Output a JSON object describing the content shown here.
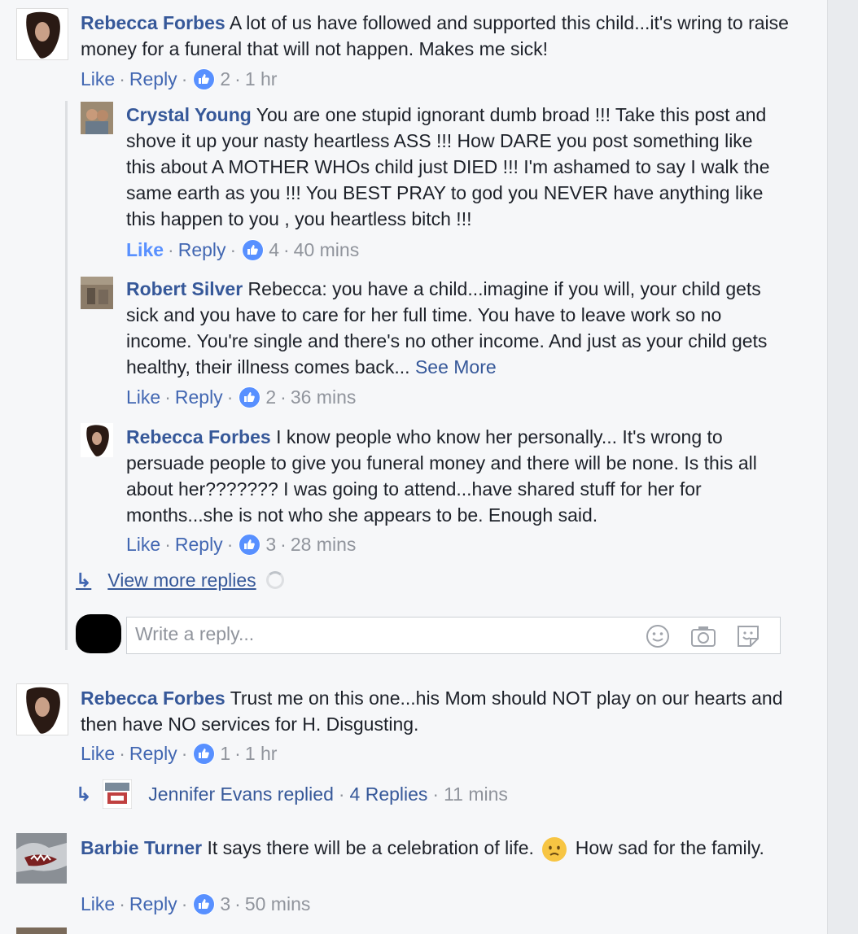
{
  "comments": [
    {
      "author": "Rebecca Forbes",
      "text": "A lot of us have followed and supported this child...it's wring to raise money for a funeral that will not happen. Makes me sick!",
      "like": "Like",
      "reply": "Reply",
      "likes": "2",
      "time": "1 hr"
    },
    {
      "author": "Crystal Young",
      "text": "You are one stupid ignorant dumb broad !!! Take this post and shove it up your nasty heartless ASS !!! How DARE you post something like this about A MOTHER WHOs child just DIED !!! I'm ashamed to say I walk the same earth as you !!! You BEST PRAY to god you NEVER have anything like this happen to you , you heartless bitch !!!",
      "like": "Like",
      "reply": "Reply",
      "likes": "4",
      "time": "40 mins"
    },
    {
      "author": "Robert Silver",
      "text": "Rebecca: you have a child...imagine if you will, your child gets sick and you have to care for her full time. You have to leave work so no income. You're single and there's no other income. And just as your child gets healthy, their illness comes back...",
      "see_more": "See More",
      "like": "Like",
      "reply": "Reply",
      "likes": "2",
      "time": "36 mins"
    },
    {
      "author": "Rebecca Forbes",
      "text": "I know people who know her personally... It's wrong to persuade people to give you funeral money and there will be none. Is this all about her??????? I was going to attend...have shared stuff for her for months...she is not who she appears to be. Enough said.",
      "like": "Like",
      "reply": "Reply",
      "likes": "3",
      "time": "28 mins"
    },
    {
      "author": "Rebecca Forbes",
      "text": "Trust me on this one...his Mom should NOT play on our hearts and then have NO services for H. Disgusting.",
      "like": "Like",
      "reply": "Reply",
      "likes": "1",
      "time": "1 hr"
    },
    {
      "author": "Barbie Turner",
      "text_before": "It says there will be a celebration of life.",
      "text_after": "How sad for the family.",
      "like": "Like",
      "reply": "Reply",
      "likes": "3",
      "time": "50 mins"
    }
  ],
  "view_more": "View more replies",
  "reply_placeholder": "Write a reply...",
  "replies_summary": {
    "name": "Jennifer Evans replied",
    "count": "4 Replies",
    "time": "11 mins"
  },
  "icons": {
    "like": "thumbs-up-icon",
    "emoji": "smiley-icon",
    "camera": "camera-icon",
    "sticker": "sticker-icon",
    "reply_arrow": "reply-arrow-icon"
  },
  "colors": {
    "author": "#365899",
    "link": "#4267b2",
    "meta": "#90949c",
    "like_badge": "#5890ff"
  }
}
